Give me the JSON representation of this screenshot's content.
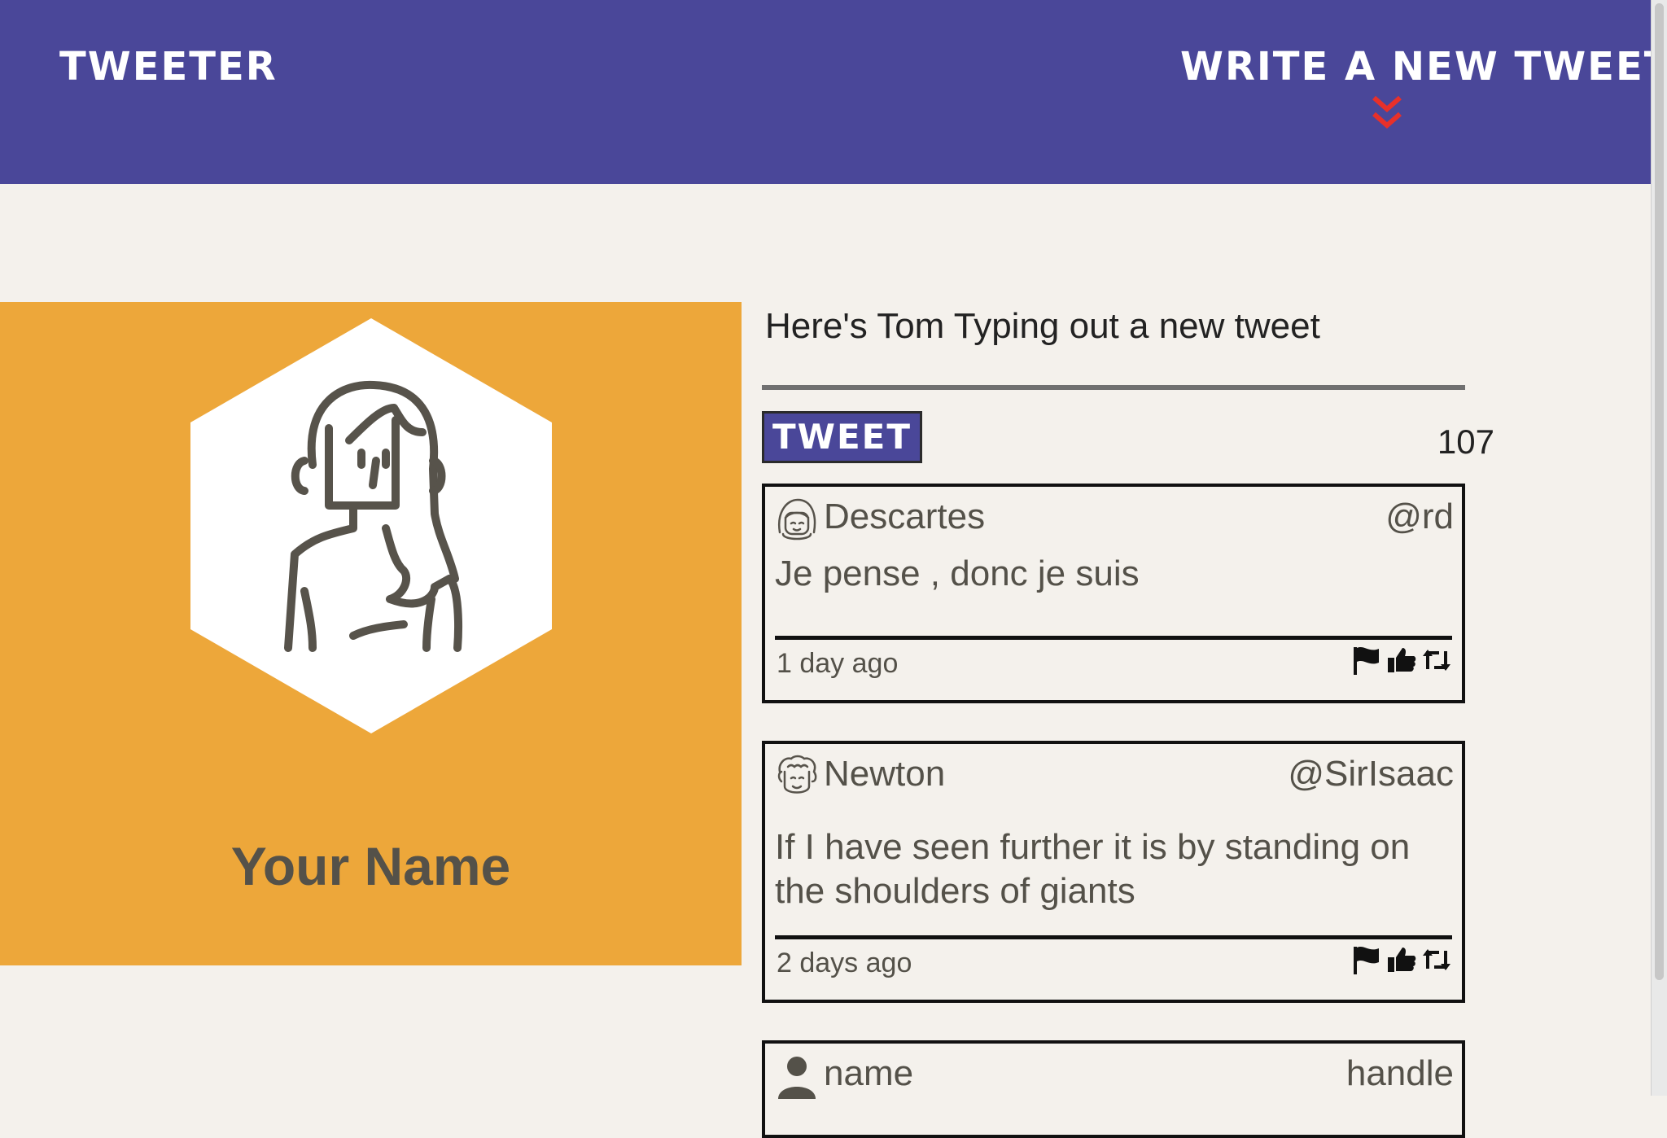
{
  "nav": {
    "brand": "TWEETER",
    "compose_toggle_label": "WRITE A NEW TWEET",
    "compose_toggle_icon": "double-chevron-down-icon",
    "accent_color": "#e8302a"
  },
  "profile": {
    "name": "Your Name",
    "avatar_icon": "woman-avatar-icon",
    "background_color": "#eda73a"
  },
  "compose": {
    "input_value": "Here's Tom Typing out a new tweet",
    "submit_label": "TWEET",
    "char_counter": "107"
  },
  "tweets": [
    {
      "name": "Descartes",
      "handle": "@rd",
      "body": "Je pense , donc je suis",
      "time": "1 day ago",
      "avatar_icon": "girl-face-avatar-icon"
    },
    {
      "name": "Newton",
      "handle": "@SirIsaac",
      "body": "If I have seen further it is by standing on the shoulders of giants",
      "time": "2 days ago",
      "avatar_icon": "curly-hair-face-avatar-icon"
    },
    {
      "name": "name",
      "handle": "handle",
      "avatar_icon": "user-silhouette-icon"
    }
  ],
  "tweet_actions": [
    "flag-icon",
    "like-icon",
    "retweet-icon"
  ],
  "colors": {
    "header_bg": "#4a4799",
    "page_bg": "#f4f1ec",
    "text": "#545149"
  }
}
